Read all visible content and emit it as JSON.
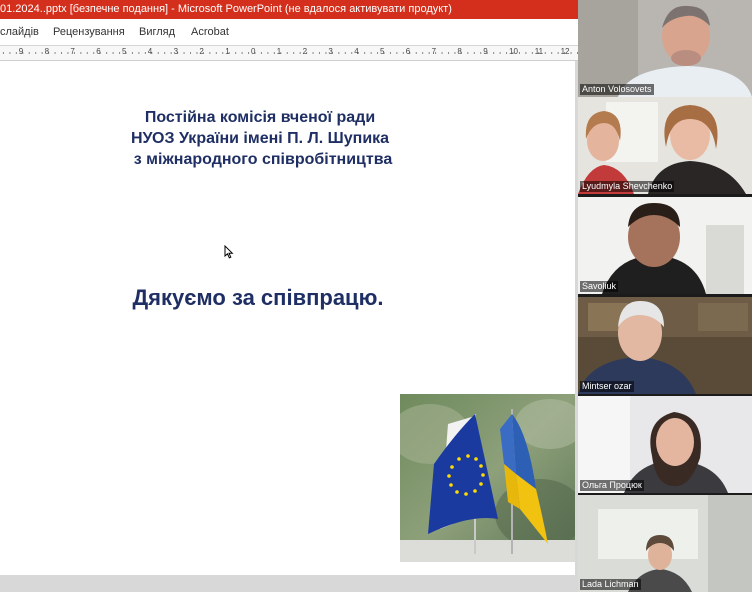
{
  "window": {
    "title": "01.2024..pptx [безпечне подання] - Microsoft PowerPoint (не вдалося активувати продукт)"
  },
  "ribbon_tabs": [
    {
      "label": "слайдів"
    },
    {
      "label": "Рецензування"
    },
    {
      "label": "Вигляд"
    },
    {
      "label": "Acrobat"
    }
  ],
  "ruler": {
    "labels": [
      "9",
      "8",
      "7",
      "6",
      "5",
      "4",
      "3",
      "2",
      "1",
      "0",
      "1",
      "2",
      "3",
      "4",
      "5",
      "6",
      "7",
      "8",
      "9",
      "10",
      "11",
      "12"
    ]
  },
  "slide": {
    "title_lines": [
      "Постійна комісія вченої ради",
      "НУОЗ України імені П. Л. Шупика",
      "з міжнародного співробітництва"
    ],
    "thanks": "Дякуємо за співпрацю."
  },
  "participants": [
    {
      "name": "Anton Volosovets"
    },
    {
      "name": "Lyudmyla Shevchenko"
    },
    {
      "name": "Savoliuk"
    },
    {
      "name": "Mintser ozar"
    },
    {
      "name": "Ольга Процюк"
    },
    {
      "name": "Lada Lichman"
    }
  ],
  "colors": {
    "titlebar": "#d32f1c",
    "slide_text": "#1f2f64",
    "eu_blue": "#1b3aa0",
    "eu_star": "#ffdd00",
    "ua_blue": "#2d5fb5",
    "ua_yellow": "#f1c20f"
  }
}
